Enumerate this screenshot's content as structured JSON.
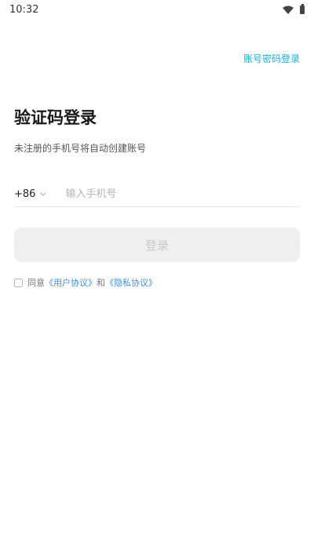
{
  "status_bar": {
    "time": "10:32"
  },
  "header": {
    "switch_login_label": "账号密码登录"
  },
  "page": {
    "title": "验证码登录",
    "subtitle": "未注册的手机号将自动创建账号"
  },
  "phone": {
    "country_code": "+86",
    "placeholder": "输入手机号",
    "value": ""
  },
  "login_button": {
    "label": "登录"
  },
  "agreement": {
    "prefix": "同意",
    "user_agreement": "《用户协议》",
    "conjunction": "和",
    "privacy_policy": "《隐私协议》",
    "checked": false
  },
  "colors": {
    "accent": "#17b0d9",
    "link": "#3d8be0",
    "button_disabled_bg": "#efefef",
    "button_disabled_text": "#c8c8c8"
  },
  "icons": [
    "wifi-icon",
    "battery-icon",
    "chevron-down-icon"
  ]
}
